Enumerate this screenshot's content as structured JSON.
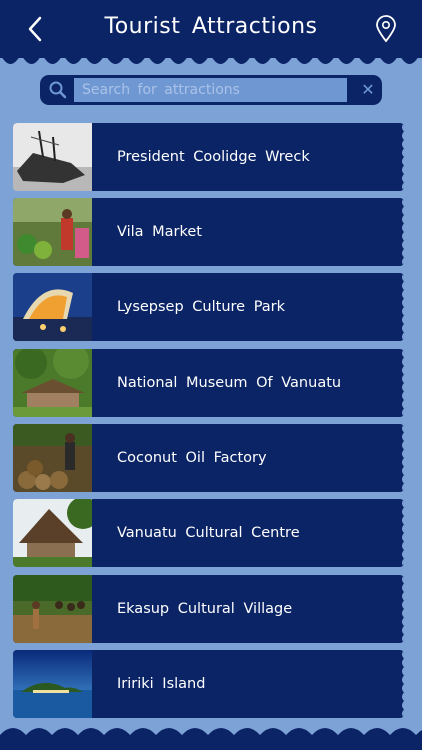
{
  "header": {
    "title": "Tourist Attractions",
    "back_icon": "chevron-left-icon",
    "map_icon": "location-pin-icon"
  },
  "search": {
    "placeholder": "Search for attractions",
    "value": "",
    "search_icon": "magnifier-icon",
    "clear_icon": "close-icon",
    "clear_symbol": "✕"
  },
  "attractions": [
    {
      "label": "President Coolidge Wreck"
    },
    {
      "label": "Vila Market"
    },
    {
      "label": "Lysepsep Culture Park"
    },
    {
      "label": "National Museum Of Vanuatu"
    },
    {
      "label": "Coconut Oil Factory"
    },
    {
      "label": "Vanuatu Cultural Centre"
    },
    {
      "label": "Ekasup Cultural Village"
    },
    {
      "label": "Iririki Island"
    }
  ],
  "colors": {
    "background": "#7da2d6",
    "primary": "#0b2466",
    "search_field": "#6f98d3",
    "text": "#ffffff"
  }
}
